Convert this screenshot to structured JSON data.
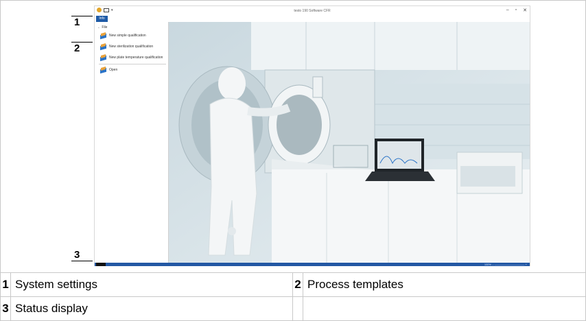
{
  "callouts": {
    "c1": "1",
    "c2": "2",
    "c3": "3"
  },
  "app": {
    "title": "testo 190 Software CFR",
    "window_controls": [
      "–",
      "▫",
      "✕"
    ],
    "tab": "Info",
    "sidebar": {
      "header": "File",
      "items": [
        {
          "label": "New simple qualification",
          "icon": "book-icon"
        },
        {
          "label": "New sterilization qualification",
          "icon": "book-icon"
        },
        {
          "label": "New plate temperature qualification",
          "icon": "book-icon"
        },
        {
          "label": "Open",
          "icon": "book-open-icon"
        }
      ]
    },
    "status": {
      "zoom": "100%"
    }
  },
  "legend": {
    "rows": [
      [
        {
          "num": "1",
          "text": "System settings"
        },
        {
          "num": "2",
          "text": "Process templates"
        }
      ],
      [
        {
          "num": "3",
          "text": "Status display"
        },
        {
          "num": "",
          "text": ""
        }
      ]
    ]
  },
  "colors": {
    "accent": "#1f5ba7",
    "statusbar": "#2358a4"
  }
}
